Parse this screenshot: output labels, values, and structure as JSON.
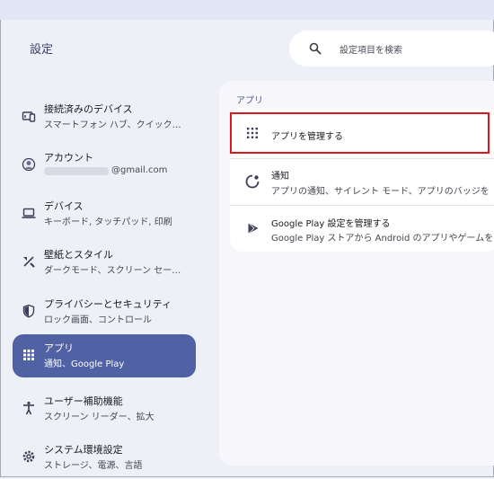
{
  "header": {
    "title": "設定",
    "search_placeholder": "設定項目を検索"
  },
  "sidebar": {
    "items": [
      {
        "title": "接続済みのデバイス",
        "subtitle": "スマートフォン ハブ、クイック…",
        "icon": "connected-devices-icon"
      },
      {
        "title": "アカウント",
        "subtitle": "@gmail.com",
        "icon": "account-icon"
      },
      {
        "title": "デバイス",
        "subtitle": "キーボード, タッチパッド, 印刷",
        "icon": "laptop-icon"
      },
      {
        "title": "壁紙とスタイル",
        "subtitle": "ダークモード、スクリーン セー…",
        "icon": "palette-brush-icon"
      },
      {
        "title": "プライバシーとセキュリティ",
        "subtitle": "ロック画面、コントロール",
        "icon": "shield-icon"
      },
      {
        "title": "アプリ",
        "subtitle": "通知、Google Play",
        "icon": "apps-grid-icon",
        "active": true
      },
      {
        "title": "ユーザー補助機能",
        "subtitle": "スクリーン リーダー、拡大",
        "icon": "accessibility-icon"
      },
      {
        "title": "システム環境設定",
        "subtitle": "ストレージ、電源、言語",
        "icon": "system-gear-icon"
      }
    ]
  },
  "main": {
    "section_label": "アプリ",
    "rows": [
      {
        "title": "アプリを管理する",
        "icon": "apps-grid-icon"
      },
      {
        "title": "通知",
        "subtitle": "アプリの通知、サイレント モード、アプリのバッジを",
        "icon": "notification-circle-icon"
      },
      {
        "title": "Google Play 設定を管理する",
        "subtitle": "Google Play ストアから Android のアプリやゲームを",
        "icon": "play-store-icon"
      }
    ]
  },
  "colors": {
    "background": "#eef0f8",
    "active_item": "#5061a4",
    "accent": "#4a5a93",
    "highlight_box": "#e0141d"
  }
}
